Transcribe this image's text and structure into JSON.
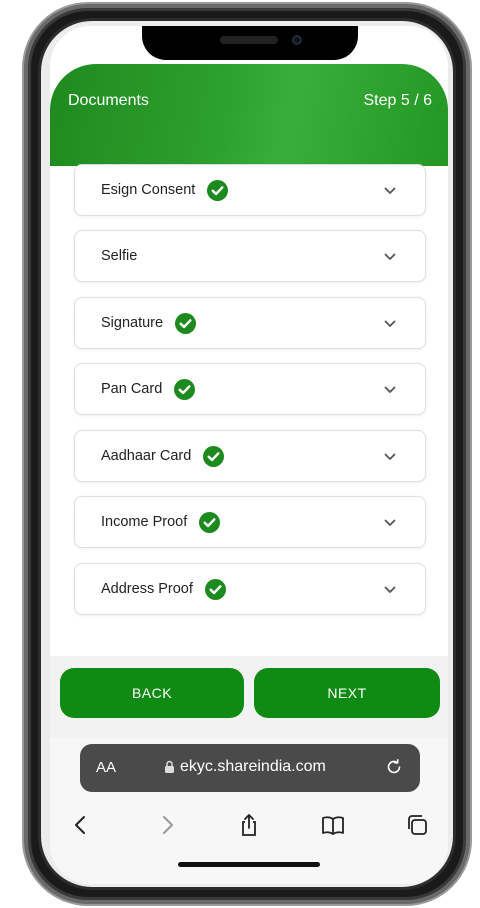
{
  "header": {
    "title": "Documents",
    "step": "Step 5 / 6"
  },
  "documents": [
    {
      "label": "Esign Consent",
      "completed": true
    },
    {
      "label": "Selfie",
      "completed": false
    },
    {
      "label": "Signature",
      "completed": true
    },
    {
      "label": "Pan Card",
      "completed": true
    },
    {
      "label": "Aadhaar Card",
      "completed": true
    },
    {
      "label": "Income Proof",
      "completed": true
    },
    {
      "label": "Address Proof",
      "completed": true
    }
  ],
  "buttons": {
    "back": "BACK",
    "next": "NEXT"
  },
  "browser": {
    "text_size": "AA",
    "url": "ekyc.shareindia.com"
  },
  "colors": {
    "accent": "#0f8a12",
    "check": "#1c8a1c",
    "header": "#2ea12e"
  },
  "icons": [
    "check-circle-icon",
    "chevron-down-icon",
    "lock-icon",
    "reload-icon",
    "back-icon",
    "forward-icon",
    "share-icon",
    "bookmarks-icon",
    "tabs-icon"
  ]
}
